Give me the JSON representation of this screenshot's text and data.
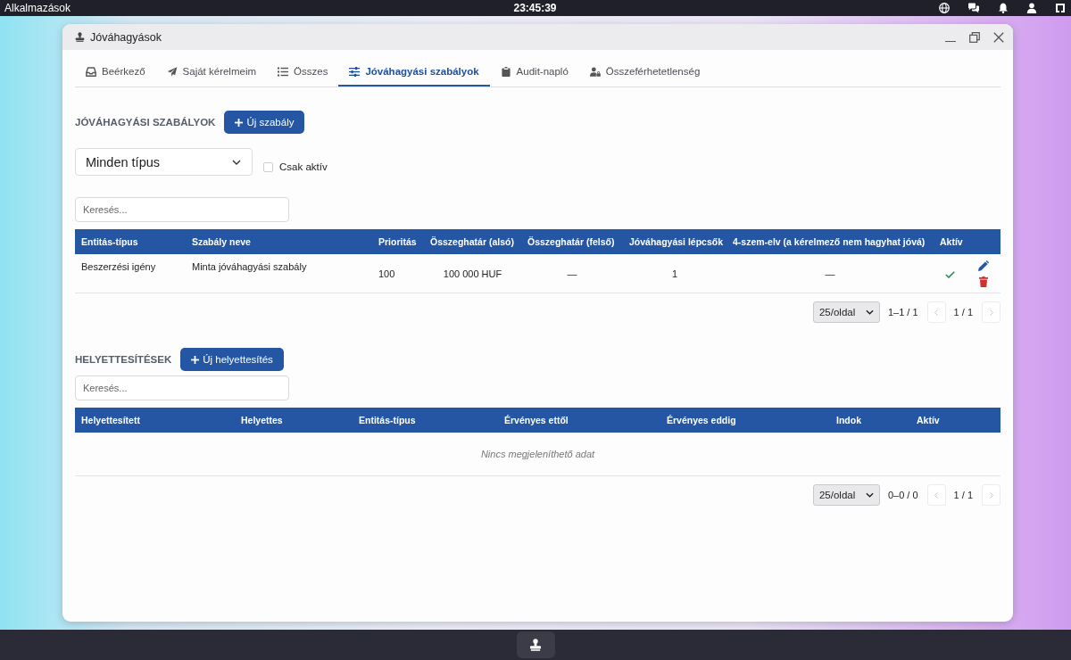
{
  "top_bar": {
    "menu": "Alkalmazások",
    "clock": "23:45:39"
  },
  "window": {
    "title": "Jóváhagyások"
  },
  "tabs": [
    {
      "label": "Beérkező",
      "selected": false
    },
    {
      "label": "Saját kérelmeim",
      "selected": false
    },
    {
      "label": "Összes",
      "selected": false
    },
    {
      "label": "Jóváhagyási szabályok",
      "selected": true
    },
    {
      "label": "Audit-napló",
      "selected": false
    },
    {
      "label": "Összeférhetetlenség",
      "selected": false
    }
  ],
  "rules": {
    "heading": "JÓVÁHAGYÁSI SZABÁLYOK",
    "new_button": "Új szabály",
    "type_filter": {
      "value": "Minden típus"
    },
    "active_only": {
      "label": "Csak aktív",
      "checked": false
    },
    "search": {
      "placeholder": "Keresés..."
    },
    "table": {
      "columns": [
        "Entitás-típus",
        "Szabály neve",
        "Prioritás",
        "Összeghatár (alsó)",
        "Összeghatár (felső)",
        "Jóváhagyási lépcsők",
        "4-szem-elv (a kérelmező nem hagyhat jóvá)",
        "Aktív"
      ],
      "rows": [
        {
          "cells": [
            "Beszerzési igény",
            "Minta jóváhagyási szabály",
            "100",
            "100 000 HUF",
            "—",
            "1",
            "—"
          ],
          "active": true
        }
      ]
    },
    "pagination": {
      "page_size": "25/oldal",
      "range": "1–1 / 1",
      "page": "1 / 1",
      "prev_disabled": true,
      "next_disabled": true
    }
  },
  "substitutions": {
    "heading": "HELYETTESÍTÉSEK",
    "new_button": "Új helyettesítés",
    "search": {
      "placeholder": "Keresés..."
    },
    "table": {
      "columns": [
        "Helyettesített",
        "Helyettes",
        "Entitás-típus",
        "Érvényes ettől",
        "Érvényes eddig",
        "Indok",
        "Aktív"
      ],
      "empty_message": "Nincs megjeleníthető adat"
    },
    "pagination": {
      "page_size": "25/oldal",
      "range": "0–0 / 0",
      "page": "1 / 1",
      "prev_disabled": true,
      "next_disabled": true
    }
  }
}
